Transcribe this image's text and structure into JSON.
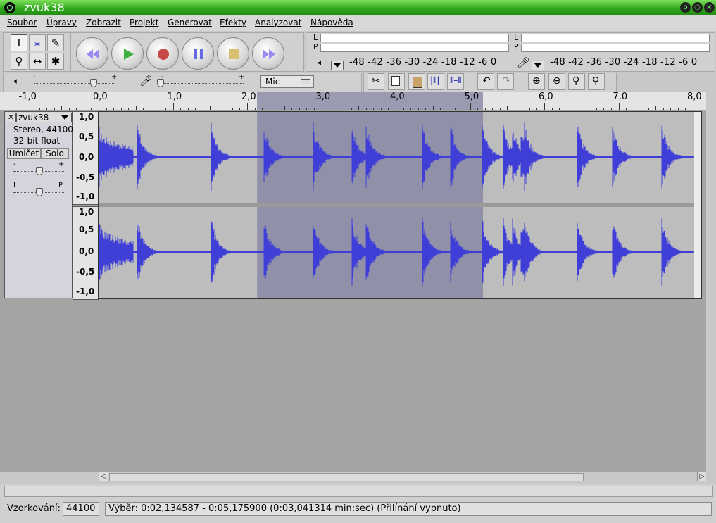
{
  "window": {
    "title": "zvuk38"
  },
  "menu": [
    "Soubor",
    "Úpravy",
    "Zobrazit",
    "Projekt",
    "Generovat",
    "Efekty",
    "Analyzovat",
    "Nápověda"
  ],
  "tools": [
    "selection-tool",
    "envelope-tool",
    "draw-tool",
    "zoom-tool",
    "timeshift-tool",
    "multi-tool"
  ],
  "transport": [
    "skip-start",
    "play",
    "record",
    "pause",
    "stop",
    "skip-end"
  ],
  "meters": {
    "output_channels": [
      "L",
      "P"
    ],
    "input_channels": [
      "L",
      "P"
    ],
    "scale": "-48 -42 -36 -30 -24 -18 -12 -6  0"
  },
  "mixer": {
    "input_source": "Mic",
    "minus": "-",
    "plus": "+"
  },
  "ruler": {
    "labels": [
      "-1,0",
      "0,0",
      "1,0",
      "2,0",
      "3,0",
      "4,0",
      "5,0",
      "6,0",
      "7,0",
      "8,0"
    ]
  },
  "track": {
    "name": "zvuk38",
    "info_rate": "Stereo, 44100Hz",
    "info_format": "32-bit float",
    "mute_label": "Umlčet",
    "solo_label": "Solo",
    "gain_minus": "-",
    "gain_plus": "+",
    "pan_left": "L",
    "pan_right": "P",
    "scale": [
      "1,0",
      "0,5",
      "0,0",
      "-0,5",
      "-1,0"
    ],
    "selection": {
      "start_sec": 2.134587,
      "end_sec": 5.1759
    }
  },
  "status": {
    "rate_label": "Vzorkování:",
    "rate_value": "44100",
    "selection_text": "Výběr: 0:02,134587 - 0:05,175900 (0:03,041314 min:sec)   (Přilínání vypnuto)"
  },
  "colors": {
    "waveform": "#3f3fd8",
    "selection": "#9090a8",
    "titlebar": "#3cb82a"
  }
}
